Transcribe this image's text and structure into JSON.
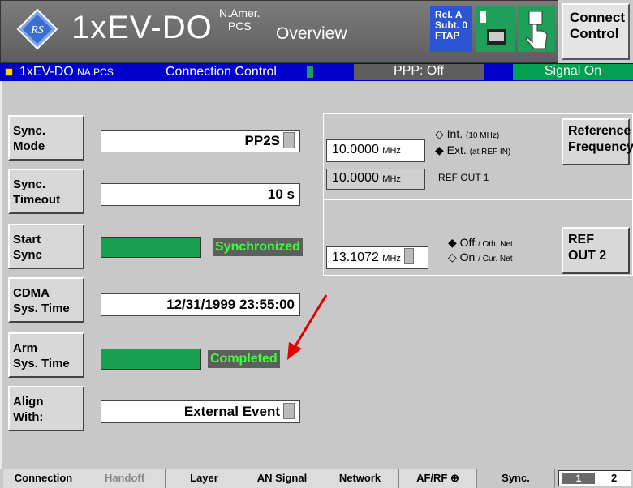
{
  "title": {
    "standard": "1xEV-DO",
    "band": "N.Amer.",
    "band_sub": "PCS",
    "screen": "Overview",
    "rel_lines": [
      "Rel. A",
      "Subt. 0",
      "FTAP"
    ],
    "connect_button": "Connect Control"
  },
  "status": {
    "left": "1xEV-DO",
    "left_sub": "NA.PCS",
    "section": "Connection Control",
    "ppp": "PPP: Off",
    "signal": "Signal On",
    "colors": {
      "bar": "#0000cc",
      "signal": "#00a050"
    }
  },
  "left_buttons": [
    {
      "line1": "Sync.",
      "line2": "Mode"
    },
    {
      "line1": "Sync.",
      "line2": "Timeout"
    },
    {
      "line1": "Start",
      "line2": "Sync"
    },
    {
      "line1": "CDMA",
      "line2": "Sys. Time"
    },
    {
      "line1": "Arm",
      "line2": "Sys. Time"
    },
    {
      "line1": "Align",
      "line2": "With:"
    }
  ],
  "fields": {
    "sync_mode": "PP2S",
    "sync_timeout": "10 s",
    "sync_status": "Synchronized",
    "cdma_sys_time": "12/31/1999 23:55:00",
    "arm_status": "Completed",
    "align_with": "External Event"
  },
  "reference": {
    "freq_value": "10.0000",
    "freq_unit": "MHz",
    "int_label": "Int.",
    "int_sub": "(10 MHz)",
    "ext_label": "Ext.",
    "ext_sub": "(at REF IN)",
    "button": [
      "Reference",
      "Frequency"
    ],
    "out1_value": "10.0000",
    "out1_unit": "MHz",
    "out1_label": "REF OUT 1"
  },
  "ref_out2": {
    "value": "13.1072",
    "unit": "MHz",
    "off_label": "Off",
    "off_sub": "/ Oth. Net",
    "on_label": "On",
    "on_sub": "/ Cur. Net",
    "button": [
      "REF",
      "OUT 2"
    ]
  },
  "tabs": [
    "Connection",
    "Handoff",
    "Layer",
    "AN Signal",
    "Network",
    "AF/RF",
    "Sync."
  ],
  "pager": {
    "page1": "1",
    "page2": "2"
  }
}
